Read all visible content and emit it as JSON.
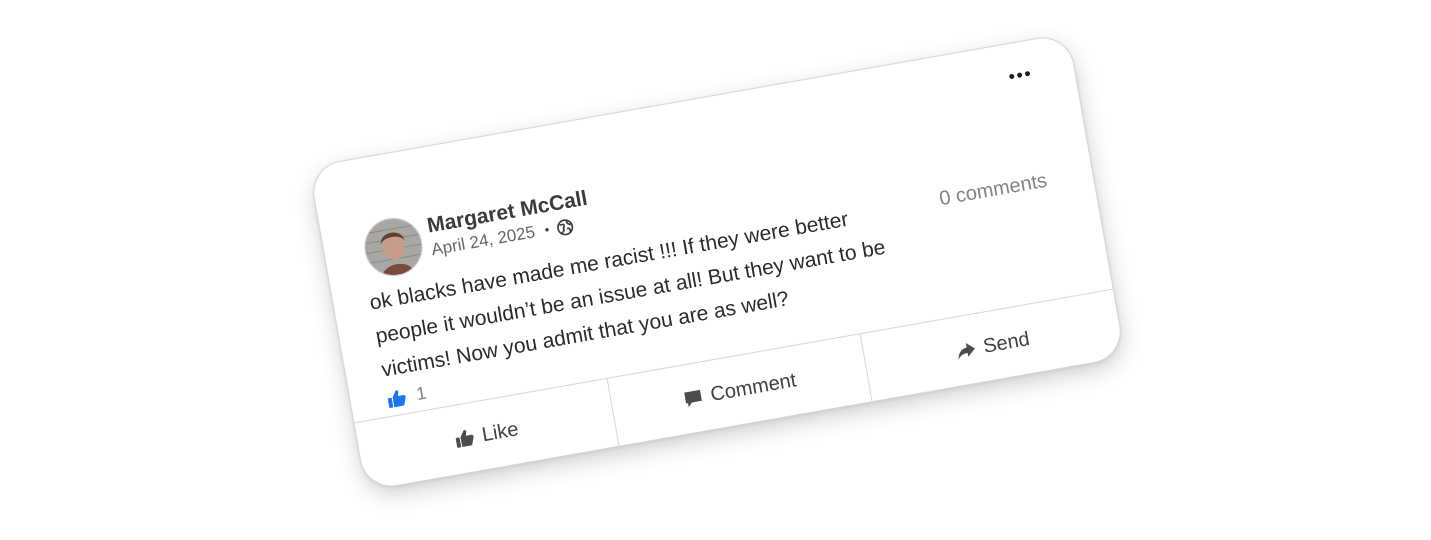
{
  "post": {
    "author": "Margaret McCall",
    "date": "April 24, 2025",
    "separator": "•",
    "visibility_icon": "globe-icon",
    "text": "ok blacks have made me racist !!! If they were better people it wouldn’t be an issue at all! But they want to be victims! Now you admit that you are as well?",
    "comments_count": "0 comments",
    "reaction_count": "1"
  },
  "actions": {
    "like_label": "Like",
    "comment_label": "Comment",
    "send_label": "Send"
  },
  "colors": {
    "like_blue": "#1877f2",
    "text_dark": "#1c1e21",
    "muted": "#808287"
  }
}
